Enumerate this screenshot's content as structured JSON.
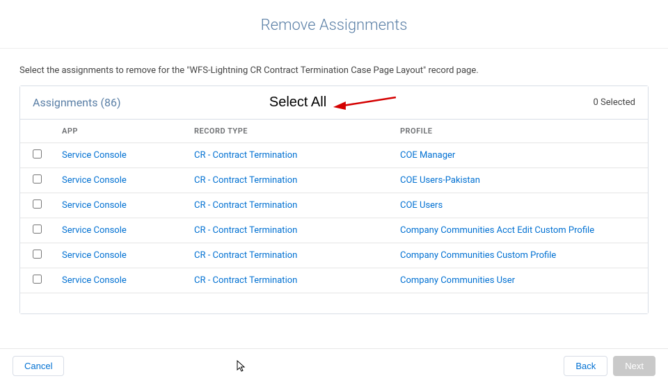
{
  "modal": {
    "title": "Remove Assignments",
    "instruction": "Select the assignments to remove for the \"WFS-Lightning CR Contract Termination Case Page Layout\" record page."
  },
  "panel": {
    "title": "Assignments (86)",
    "select_all_label": "Select All",
    "selected_text": "0 Selected"
  },
  "columns": {
    "app": "APP",
    "record_type": "RECORD TYPE",
    "profile": "PROFILE"
  },
  "rows": [
    {
      "app": "Service Console",
      "record_type": "CR - Contract Termination",
      "profile": "COE Manager"
    },
    {
      "app": "Service Console",
      "record_type": "CR - Contract Termination",
      "profile": "COE Users-Pakistan"
    },
    {
      "app": "Service Console",
      "record_type": "CR - Contract Termination",
      "profile": "COE Users"
    },
    {
      "app": "Service Console",
      "record_type": "CR - Contract Termination",
      "profile": "Company Communities Acct Edit Custom Profile"
    },
    {
      "app": "Service Console",
      "record_type": "CR - Contract Termination",
      "profile": "Company Communities Custom Profile"
    },
    {
      "app": "Service Console",
      "record_type": "CR - Contract Termination",
      "profile": "Company Communities User"
    }
  ],
  "footer": {
    "cancel": "Cancel",
    "back": "Back",
    "next": "Next"
  }
}
